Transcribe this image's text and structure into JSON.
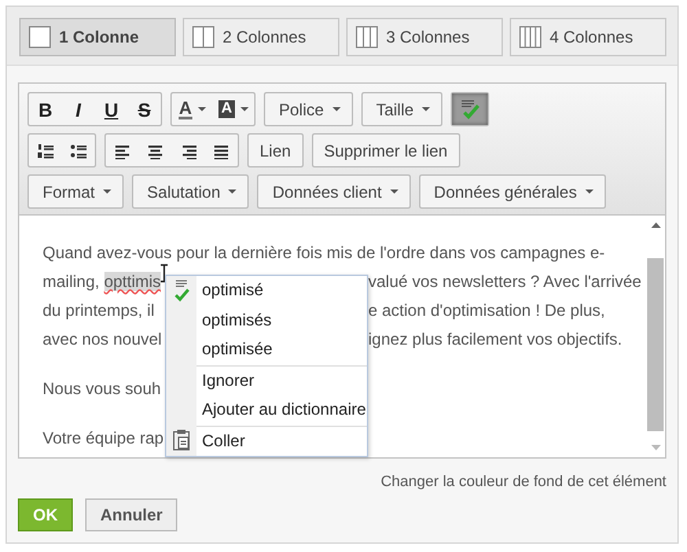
{
  "layouts": [
    {
      "label": "1 Colonne",
      "selected": true
    },
    {
      "label": "2 Colonnes",
      "selected": false
    },
    {
      "label": "3 Colonnes",
      "selected": false
    },
    {
      "label": "4 Colonnes",
      "selected": false
    }
  ],
  "toolbar": [
    [
      [
        {
          "kind": "bold",
          "label": "B"
        },
        {
          "kind": "italic",
          "label": "I"
        },
        {
          "kind": "underline",
          "label": "U"
        },
        {
          "kind": "strike",
          "label": "S"
        }
      ],
      [
        {
          "kind": "text-color",
          "label": "A"
        },
        {
          "kind": "highlight-color",
          "label": "A"
        }
      ],
      [
        {
          "kind": "dropdown",
          "label": "Police"
        }
      ],
      [
        {
          "kind": "dropdown",
          "label": "Taille"
        }
      ],
      [
        {
          "kind": "spellcheck",
          "on": true
        }
      ]
    ],
    [
      [
        {
          "kind": "ordered-list"
        },
        {
          "kind": "bullet-list"
        }
      ],
      [
        {
          "kind": "align-left"
        },
        {
          "kind": "align-center"
        },
        {
          "kind": "align-right"
        },
        {
          "kind": "justify"
        }
      ],
      [
        {
          "kind": "button",
          "label": "Lien"
        }
      ],
      [
        {
          "kind": "button",
          "label": "Supprimer le lien"
        }
      ]
    ],
    [
      [
        {
          "kind": "dropdown",
          "label": "Format"
        }
      ],
      [
        {
          "kind": "dropdown",
          "label": "Salutation"
        }
      ],
      [
        {
          "kind": "dropdown",
          "label": "Données client"
        }
      ],
      [
        {
          "kind": "dropdown",
          "label": "Données générales"
        }
      ]
    ]
  ],
  "paragraphs": [
    [
      {
        "left": "Quand avez-vous pour la dernière fois mis de l'ordre dans vos campagnes e-"
      },
      {
        "left": "mailing, ",
        "misspelled": "opttimis",
        "right": "valué vos newsletters ? Avec l'arrivée"
      },
      {
        "left": "du printemps, il",
        "right": "e action d'optimisation ! De plus,"
      },
      {
        "left": "avec nos nouvel",
        "right": "ignez plus facilement vos objectifs."
      }
    ],
    [
      {
        "left": "Nous vous souh"
      }
    ],
    [
      {
        "left": "Votre équipe rap"
      }
    ]
  ],
  "context_menu": [
    {
      "kind": "suggestions",
      "items": [
        "optimisé",
        "optimisés",
        "optimisée"
      ]
    },
    {
      "kind": "actions",
      "items": [
        "Ignorer",
        "Ajouter au dictionnaire"
      ]
    },
    {
      "kind": "clipboard",
      "items": [
        "Coller"
      ]
    }
  ],
  "background_link": "Changer la couleur de fond de cet élément",
  "buttons": [
    {
      "label": "OK",
      "kind": "primary"
    },
    {
      "label": "Annuler",
      "kind": "secondary"
    }
  ]
}
